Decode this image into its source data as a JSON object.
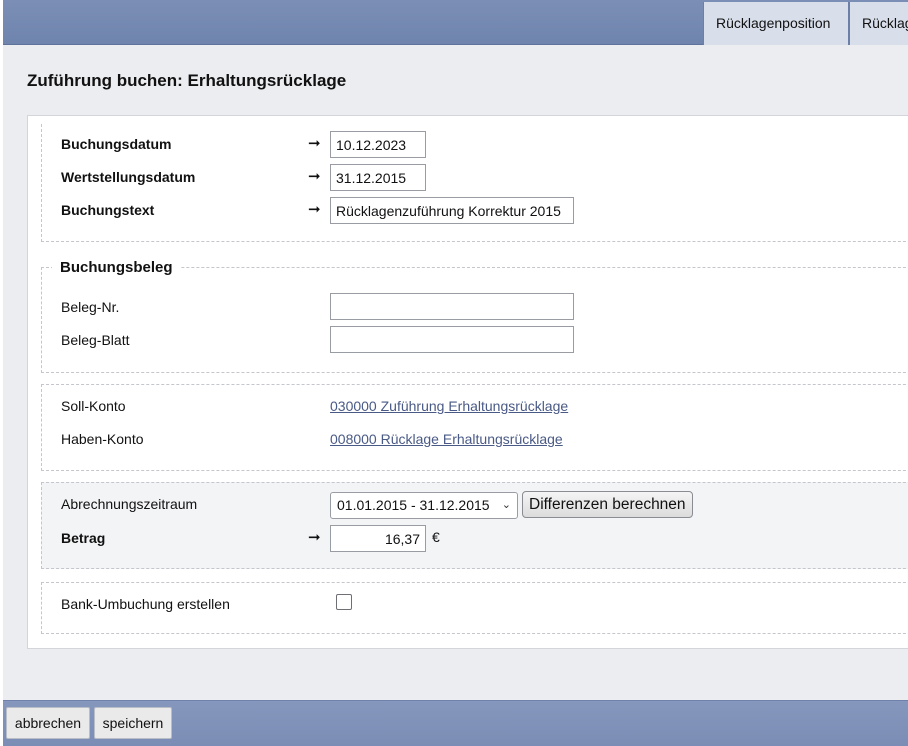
{
  "tabs": [
    {
      "label": "Rücklagenposition"
    },
    {
      "label": "Rücklag"
    }
  ],
  "page_title": "Zuführung buchen: Erhaltungsrücklage",
  "booking": {
    "date_label": "Buchungsdatum",
    "date_value": "10.12.2023",
    "value_date_label": "Wertstellungsdatum",
    "value_date_value": "31.12.2015",
    "text_label": "Buchungstext",
    "text_value": "Rücklagenzuführung Korrektur 2015",
    "arrow": "➞"
  },
  "voucher": {
    "legend": "Buchungsbeleg",
    "number_label": "Beleg-Nr.",
    "number_value": "",
    "sheet_label": "Beleg-Blatt",
    "sheet_value": ""
  },
  "accounts": {
    "debit_label": "Soll-Konto",
    "debit_value": "030000 Zuführung Erhaltungsrücklage",
    "credit_label": "Haben-Konto",
    "credit_value": "008000 Rücklage Erhaltungsrücklage"
  },
  "settlement": {
    "period_label": "Abrechnungszeitraum",
    "period_selected": "01.01.2015 - 31.12.2015",
    "calc_button": "Differenzen berechnen",
    "amount_label": "Betrag",
    "amount_value": "16,37",
    "currency": "€"
  },
  "bank": {
    "label": "Bank-Umbuchung erstellen",
    "checked": false
  },
  "footer": {
    "cancel": "abbrechen",
    "save": "speichern"
  }
}
